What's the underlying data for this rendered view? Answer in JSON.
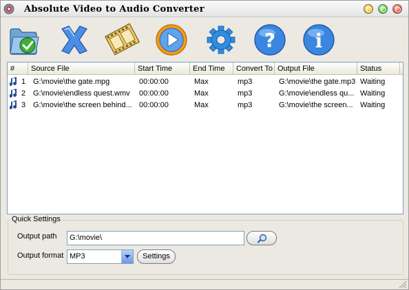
{
  "window": {
    "title": "Absolute Video to Audio Converter",
    "controls": [
      "minimize",
      "maximize",
      "close"
    ]
  },
  "toolbar": {
    "buttons": [
      {
        "icon": "add-folder-icon"
      },
      {
        "icon": "delete-icon"
      },
      {
        "icon": "film-clip-icon"
      },
      {
        "icon": "play-convert-icon"
      },
      {
        "icon": "gear-icon"
      },
      {
        "icon": "help-icon"
      },
      {
        "icon": "info-icon"
      }
    ]
  },
  "list": {
    "columns": [
      "#",
      "Source File",
      "Start Time",
      "End Time",
      "Convert To",
      "Output File",
      "Status"
    ],
    "rows": [
      {
        "num": "1",
        "source": "G:\\movie\\the gate.mpg",
        "start": "00:00:00",
        "end": "Max",
        "convert_to": "mp3",
        "output": "G:\\movie\\the gate.mp3",
        "status": "Waiting"
      },
      {
        "num": "2",
        "source": "G:\\movie\\endless quest.wmv",
        "start": "00:00:00",
        "end": "Max",
        "convert_to": "mp3",
        "output": "G:\\movie\\endless qu...",
        "status": "Waiting"
      },
      {
        "num": "3",
        "source": "G:\\movie\\the screen behind...",
        "start": "00:00:00",
        "end": "Max",
        "convert_to": "mp3",
        "output": "G:\\movie\\the screen...",
        "status": "Waiting"
      }
    ]
  },
  "quick_settings": {
    "legend": "Quick Settings",
    "output_path_label": "Output path",
    "output_path_value": "G:\\movie\\",
    "output_format_label": "Output format",
    "output_format_value": "MP3",
    "settings_button": "Settings"
  },
  "colors": {
    "accent_blue": "#3a7bd5",
    "delete_blue": "#4a8ee8",
    "gear_blue": "#2f8de0",
    "play_orange": "#f39a1c"
  }
}
